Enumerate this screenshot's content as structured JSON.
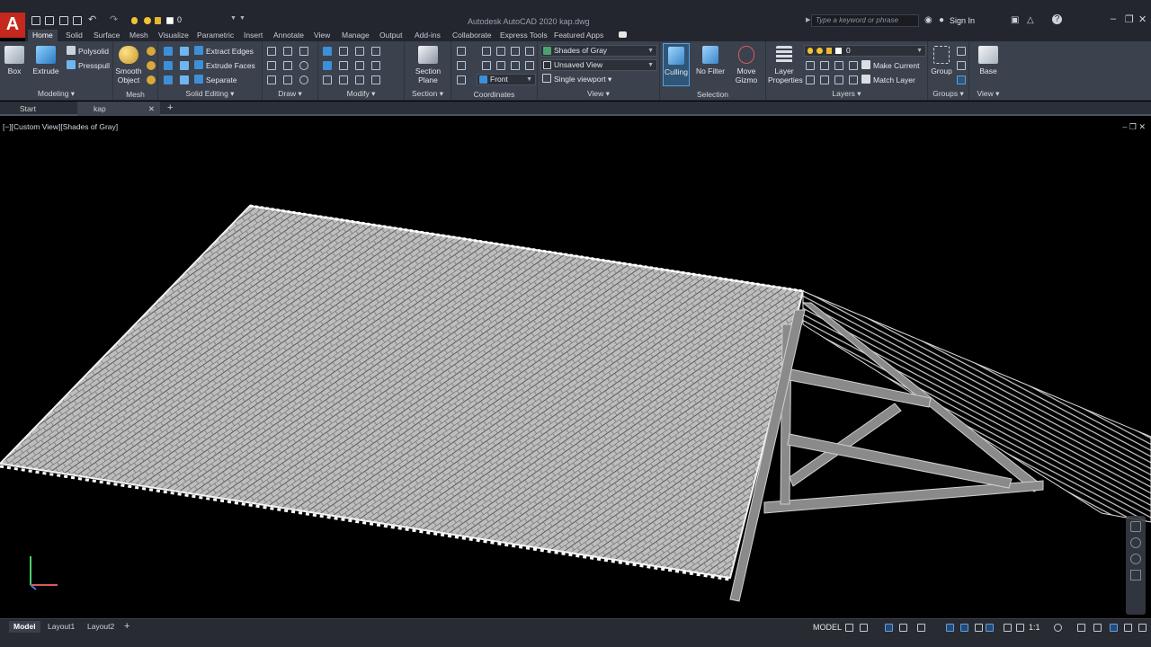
{
  "app": {
    "logo": "A",
    "title": "Autodesk AutoCAD 2020    kap.dwg",
    "qa_layer_value": "0"
  },
  "search": {
    "placeholder": "Type a keyword or phrase"
  },
  "account": {
    "signin": "Sign In"
  },
  "ribbon_tabs": [
    "Home",
    "Solid",
    "Surface",
    "Mesh",
    "Visualize",
    "Parametric",
    "Insert",
    "Annotate",
    "View",
    "Manage",
    "Output",
    "Add-ins",
    "Collaborate",
    "Express Tools",
    "Featured Apps"
  ],
  "ribbon": {
    "modeling": {
      "title": "Modeling",
      "box": "Box",
      "extrude": "Extrude",
      "polysolid": "Polysolid",
      "presspull": "Presspull"
    },
    "mesh": {
      "title": "Mesh",
      "smooth_object_1": "Smooth",
      "smooth_object_2": "Object"
    },
    "solid_editing": {
      "title": "Solid Editing",
      "extract_edges": "Extract Edges",
      "extrude_faces": "Extrude Faces",
      "separate": "Separate"
    },
    "draw": {
      "title": "Draw"
    },
    "modify": {
      "title": "Modify"
    },
    "section": {
      "title": "Section",
      "plane_1": "Section",
      "plane_2": "Plane"
    },
    "coordinates": {
      "title": "Coordinates",
      "front": "Front"
    },
    "view": {
      "title": "View",
      "visual_style": "Shades of Gray",
      "named_view": "Unsaved View",
      "viewport": "Single viewport"
    },
    "selection": {
      "title": "Selection",
      "culling": "Culling",
      "no_filter": "No Filter",
      "move_gizmo_1": "Move",
      "move_gizmo_2": "Gizmo"
    },
    "layers": {
      "title": "Layers",
      "layer_props_1": "Layer",
      "layer_props_2": "Properties",
      "current_layer": "0",
      "make_current": "Make Current",
      "match_layer": "Match Layer"
    },
    "groups": {
      "title": "Groups",
      "group": "Group"
    },
    "view2": {
      "title": "View",
      "base": "Base"
    }
  },
  "file_tabs": {
    "start": "Start",
    "kap": "kap"
  },
  "viewport": {
    "label": "[−][Custom View][Shades of Gray]"
  },
  "layout_tabs": [
    "Model",
    "Layout1",
    "Layout2"
  ],
  "status": {
    "model": "MODEL",
    "scale": "1:1"
  },
  "colors": {
    "accent": "#3d8fd8",
    "logo_red": "#c5281c",
    "ribbon": "#3b414d",
    "titlebar": "#23262e"
  }
}
